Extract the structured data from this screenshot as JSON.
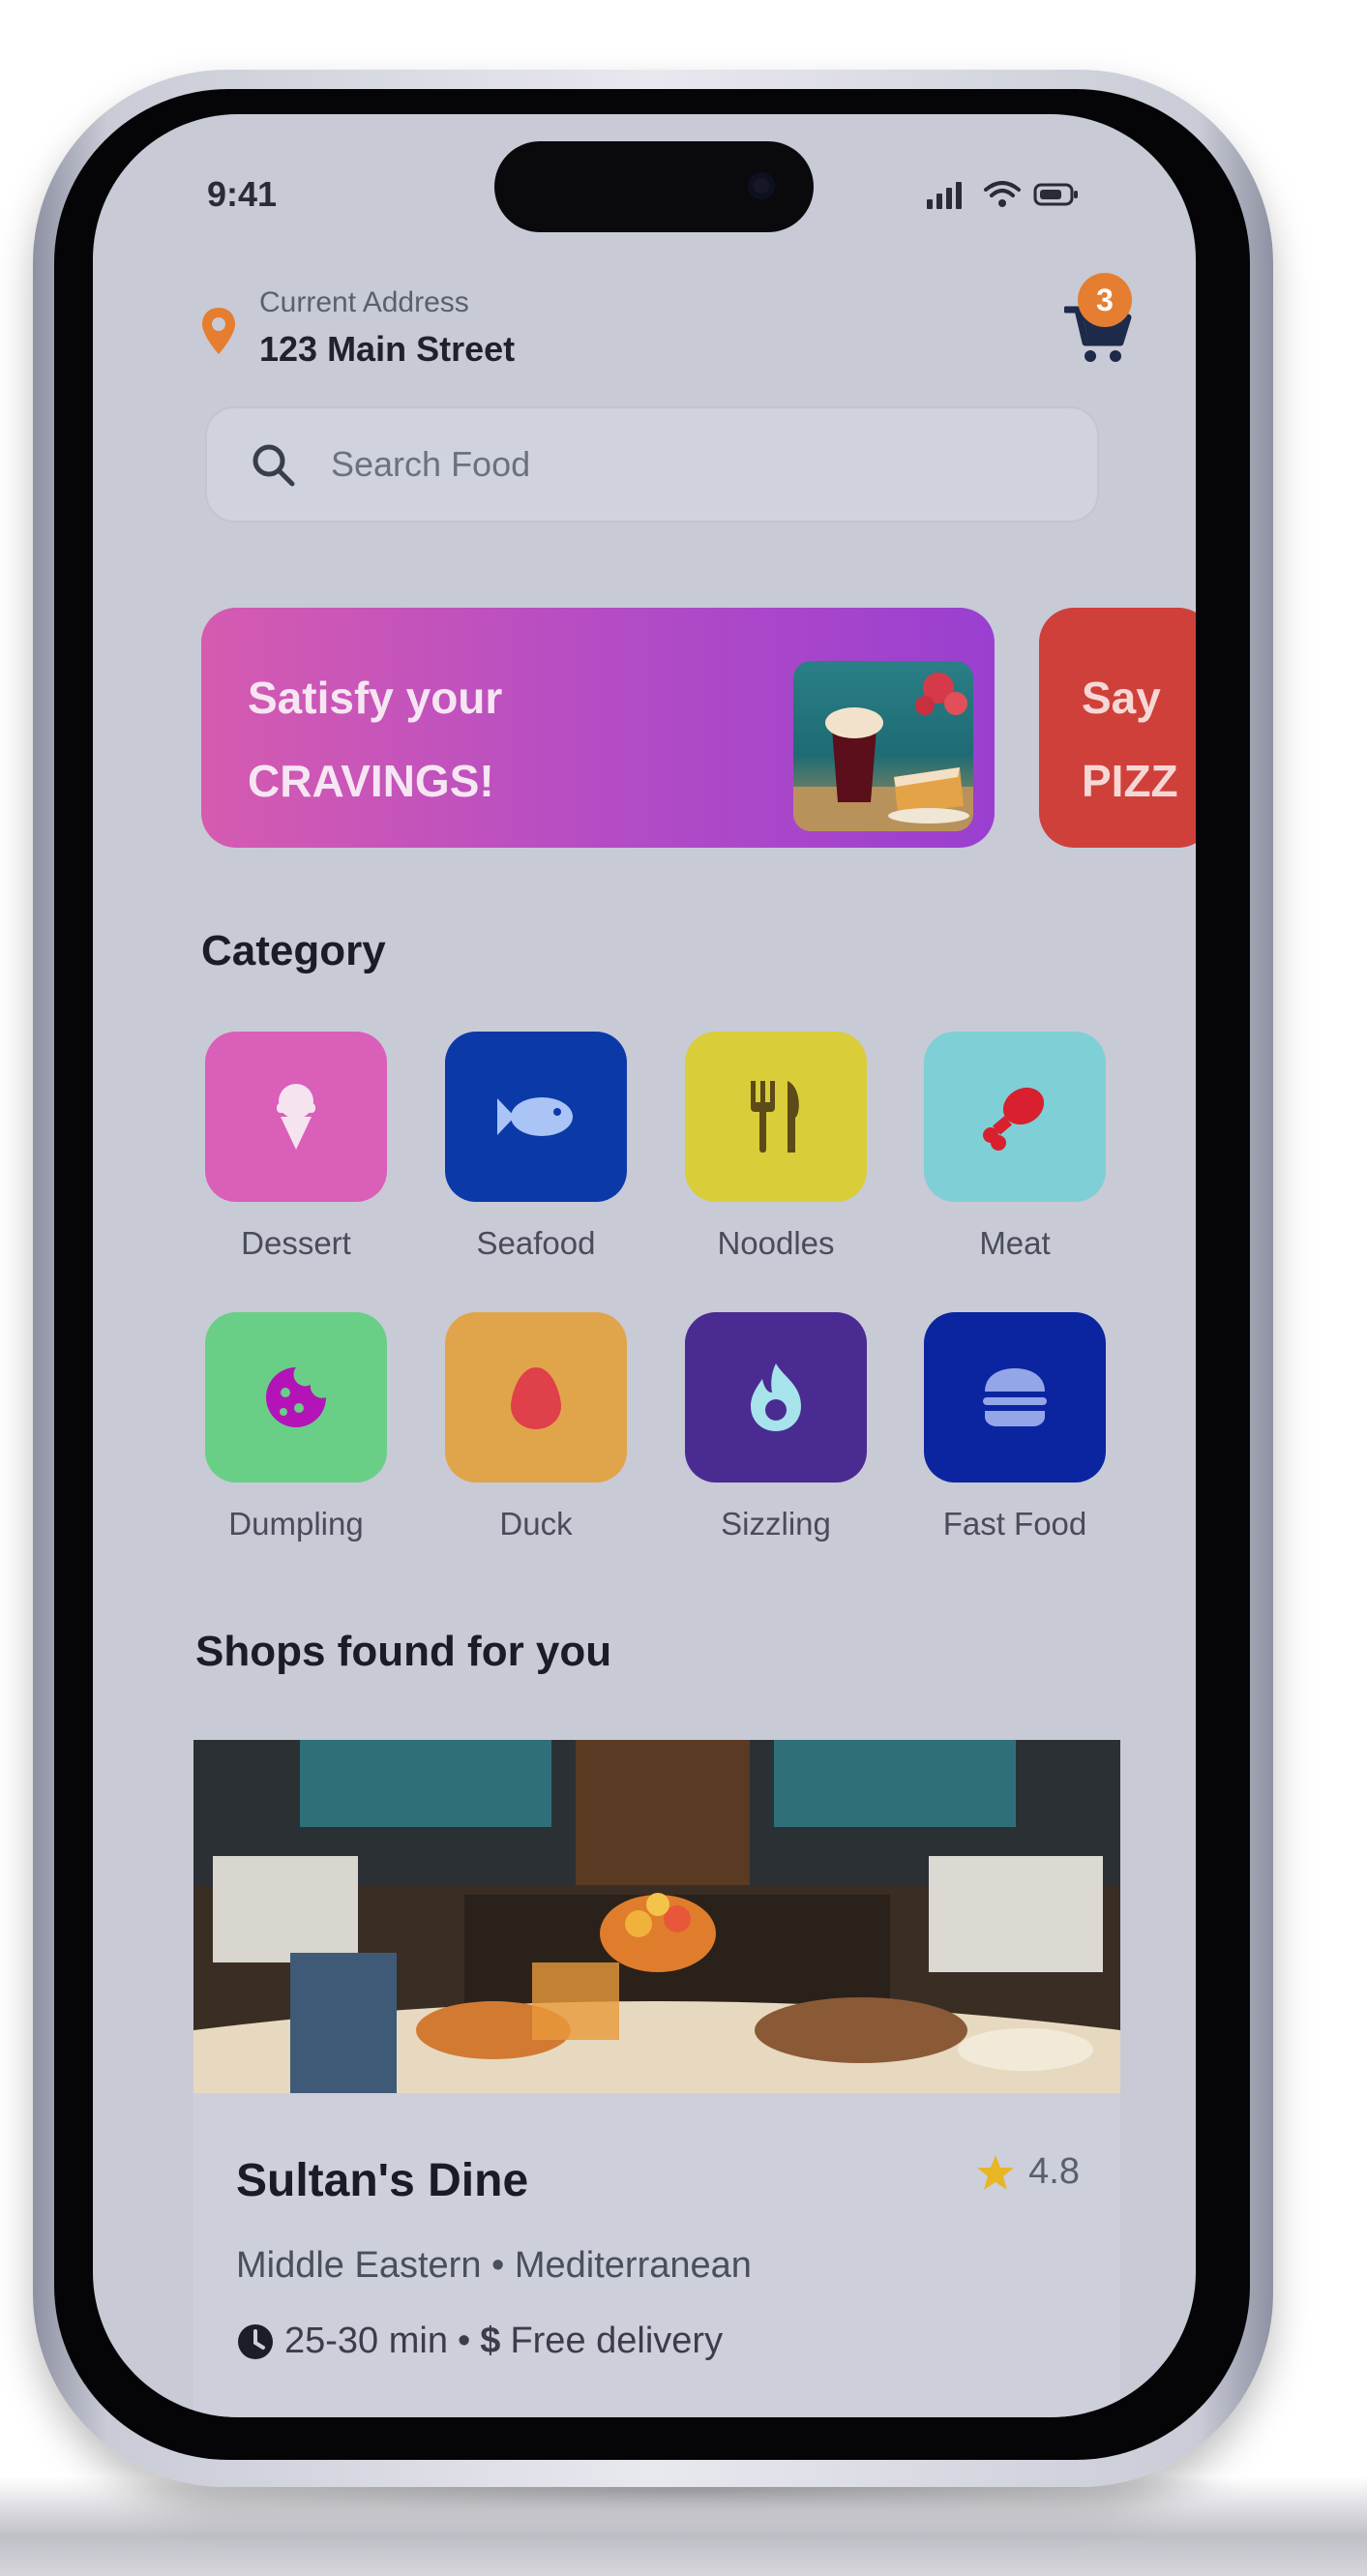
{
  "status_bar": {
    "time": "9:41"
  },
  "address": {
    "label": "Current Address",
    "value": "123 Main Street"
  },
  "cart": {
    "badge_count": "3"
  },
  "search": {
    "placeholder": "Search Food"
  },
  "banners": [
    {
      "line1": "Satisfy your",
      "line2": "CRAVINGS!",
      "color": "#c24fbf"
    },
    {
      "line1": "Say",
      "line2": "PIZZ",
      "color": "#d0403a"
    }
  ],
  "category": {
    "title": "Category",
    "items": [
      {
        "label": "Dessert",
        "icon": "ice-cream-icon",
        "color": "#d95fb8"
      },
      {
        "label": "Seafood",
        "icon": "fish-icon",
        "color": "#0b3aa8"
      },
      {
        "label": "Noodles",
        "icon": "utensils-icon",
        "color": "#d9cd3a"
      },
      {
        "label": "Meat",
        "icon": "drumstick-icon",
        "color": "#7fcfd6"
      },
      {
        "label": "Dumpling",
        "icon": "cookie-icon",
        "color": "#69cf87"
      },
      {
        "label": "Duck",
        "icon": "egg-icon",
        "color": "#e0a54a"
      },
      {
        "label": "Sizzling",
        "icon": "flame-icon",
        "color": "#4a2b92"
      },
      {
        "label": "Fast Food",
        "icon": "burger-icon",
        "color": "#0b24a0"
      }
    ]
  },
  "shops": {
    "title": "Shops found for you",
    "items": [
      {
        "name": "Sultan's Dine",
        "rating": "4.8",
        "cuisine": "Middle Eastern • Mediterranean",
        "time": "25-30 min",
        "separator": "•",
        "delivery": "Free delivery"
      }
    ]
  },
  "colors": {
    "accent": "#e57e30",
    "rating_star": "#e8b624"
  }
}
